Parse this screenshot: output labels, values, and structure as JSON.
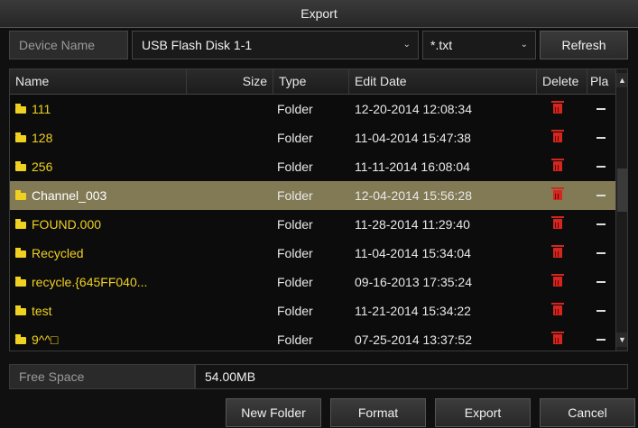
{
  "window": {
    "title": "Export"
  },
  "device": {
    "label": "Device Name",
    "value": "USB Flash Disk 1-1",
    "filter": "*.txt",
    "refresh_label": "Refresh"
  },
  "table": {
    "columns": [
      "Name",
      "Size",
      "Type",
      "Edit Date",
      "Delete",
      "Play"
    ],
    "columns_visible": [
      "Name",
      "Size",
      "Type",
      "Edit Date",
      "Delete",
      "Pla"
    ],
    "rows": [
      {
        "name": "111",
        "type": "Folder",
        "date": "12-20-2014 12:08:34",
        "selected": false
      },
      {
        "name": "128",
        "type": "Folder",
        "date": "11-04-2014 15:47:38",
        "selected": false
      },
      {
        "name": "256",
        "type": "Folder",
        "date": "11-11-2014 16:08:04",
        "selected": false
      },
      {
        "name": "Channel_003",
        "type": "Folder",
        "date": "12-04-2014 15:56:28",
        "selected": true
      },
      {
        "name": "FOUND.000",
        "type": "Folder",
        "date": "11-28-2014 11:29:40",
        "selected": false
      },
      {
        "name": "Recycled",
        "type": "Folder",
        "date": "11-04-2014 15:34:04",
        "selected": false
      },
      {
        "name": "recycle.{645FF040...",
        "type": "Folder",
        "date": "09-16-2013 17:35:24",
        "selected": false
      },
      {
        "name": "test",
        "type": "Folder",
        "date": "11-21-2014 15:34:22",
        "selected": false
      },
      {
        "name": "9^^□",
        "type": "Folder",
        "date": "07-25-2014 13:37:52",
        "selected": false
      }
    ]
  },
  "free_space": {
    "label": "Free Space",
    "value": "54.00MB"
  },
  "buttons": {
    "new_folder": "New Folder",
    "format": "Format",
    "export": "Export",
    "cancel": "Cancel"
  },
  "colors": {
    "folder_name": "#f0d020",
    "selected_row": "#827a55",
    "delete_icon": "#d2261f"
  }
}
